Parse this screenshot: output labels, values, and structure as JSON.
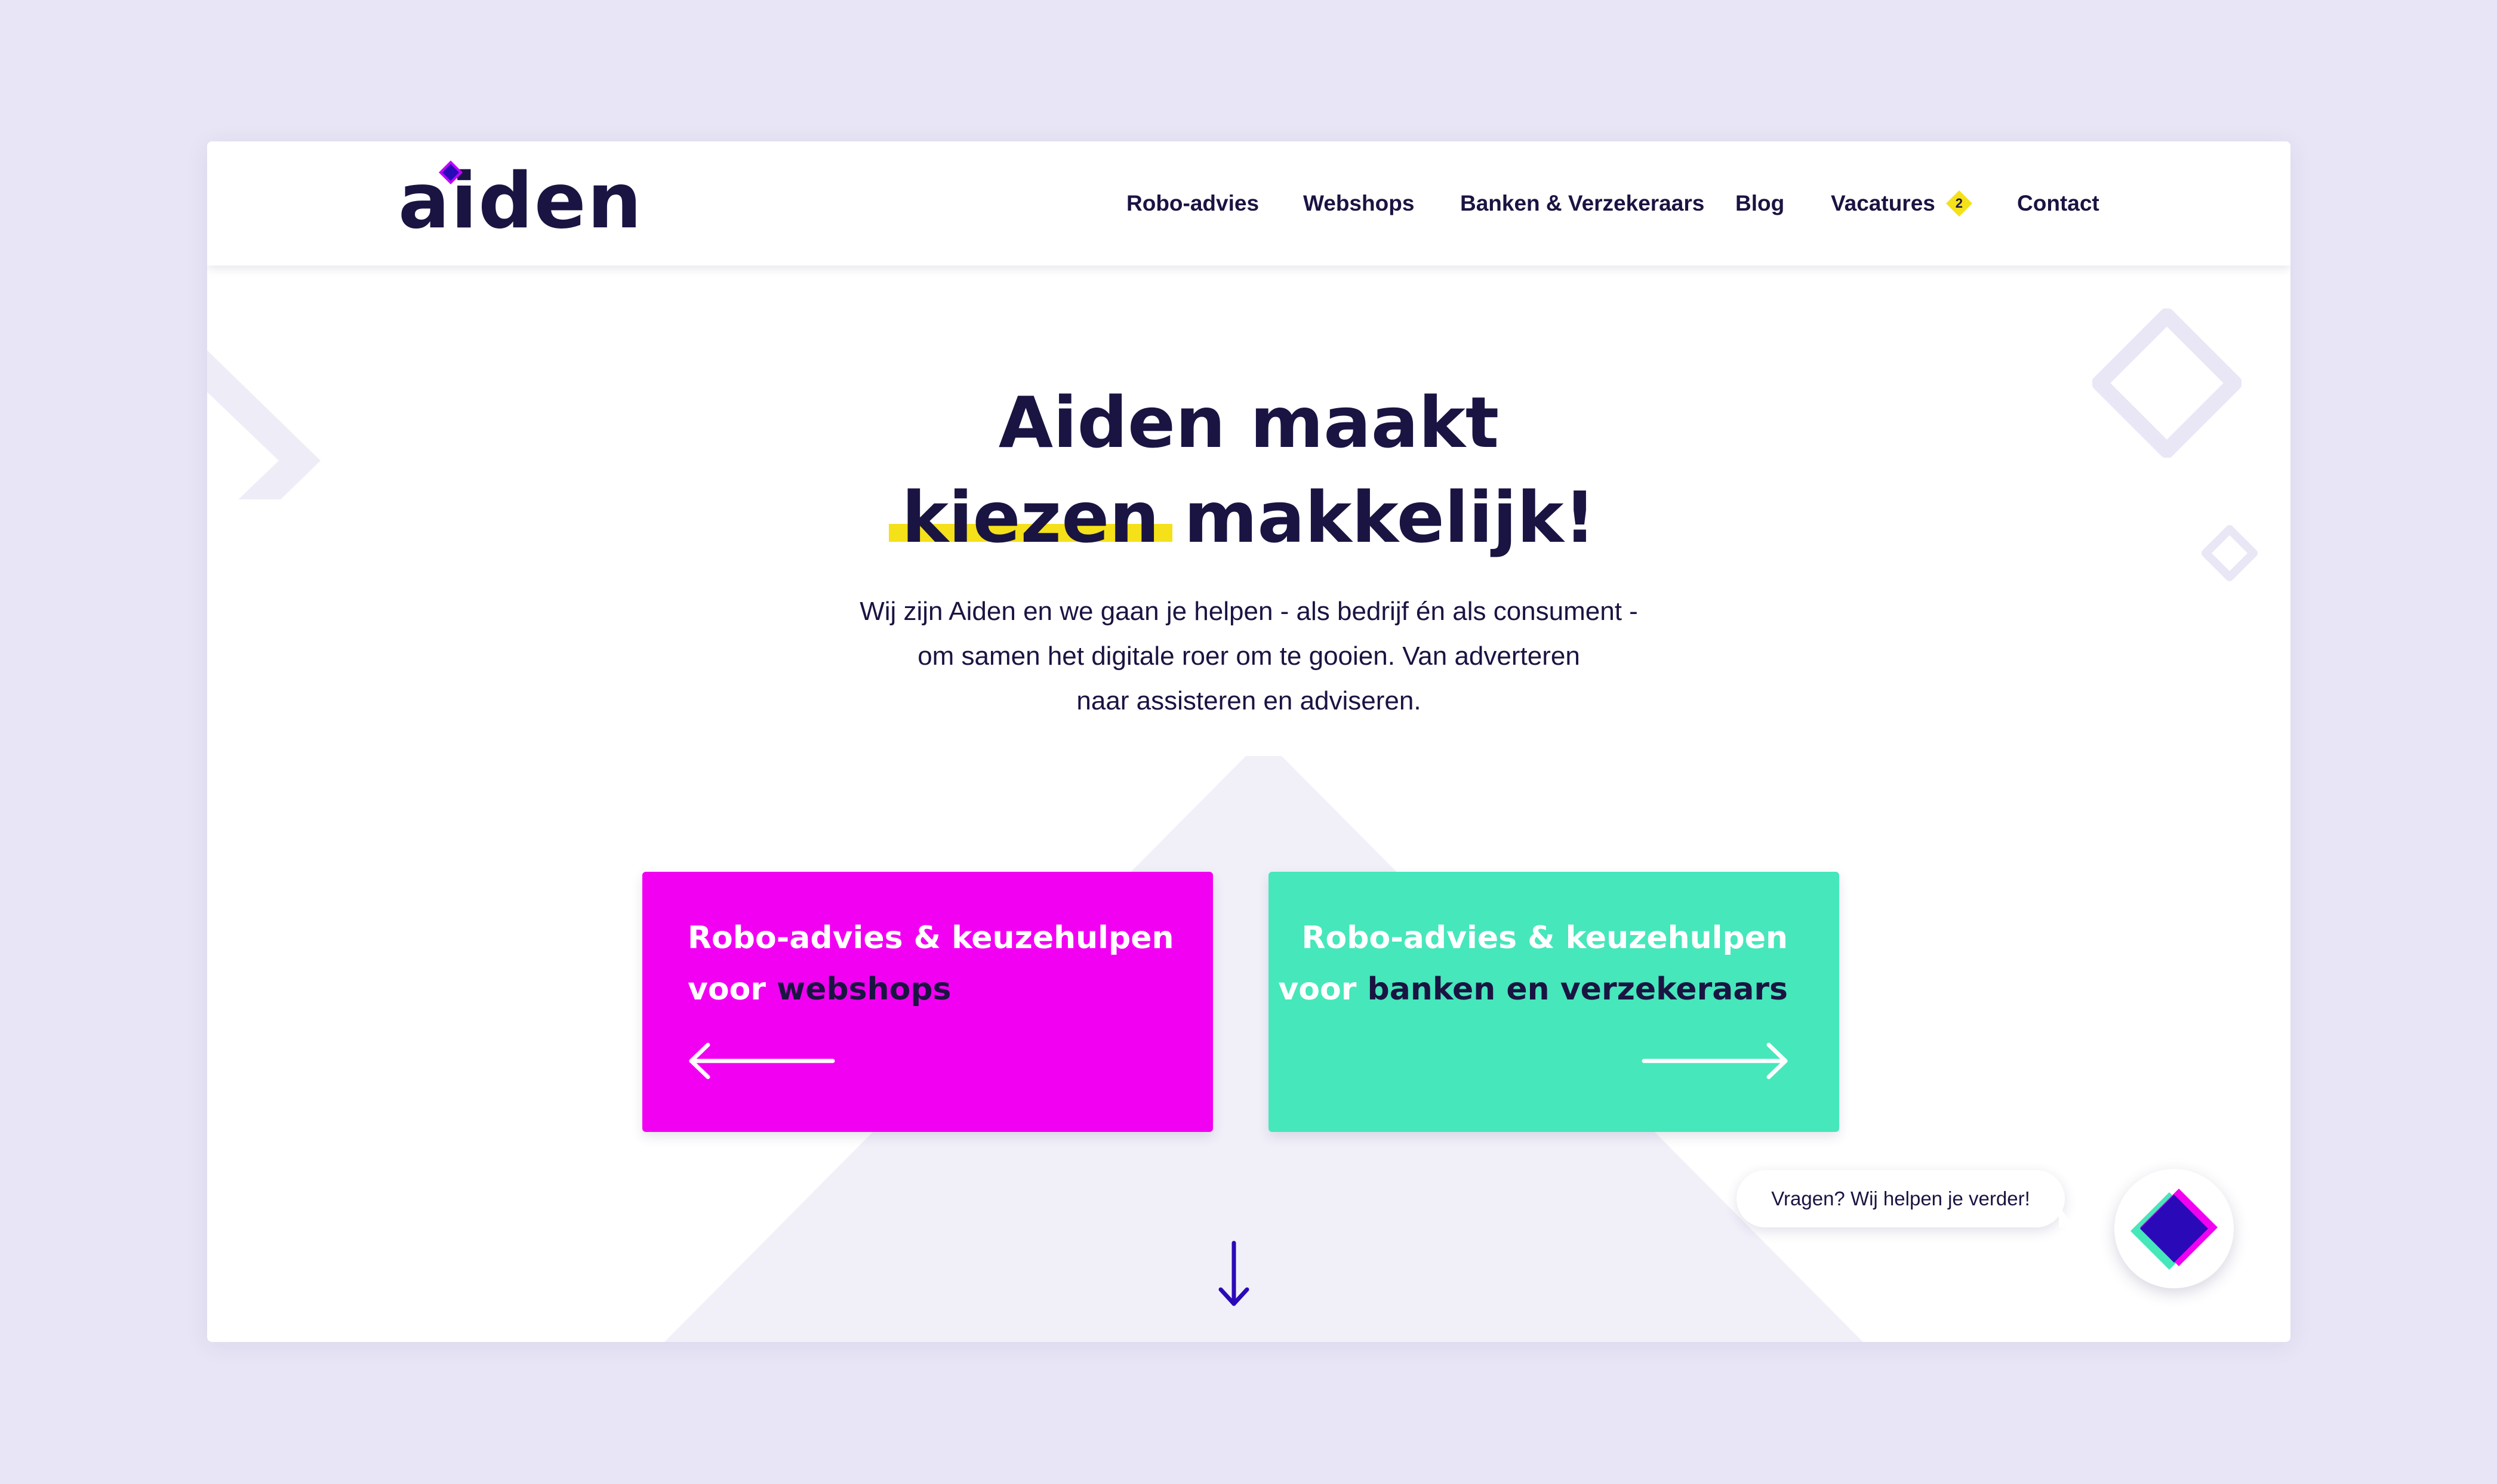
{
  "brand": {
    "logo_text": "aiden",
    "colors": {
      "navy": "#1a1442",
      "magenta": "#f200f2",
      "mint": "#46e7bb",
      "yellow": "#f4e11a",
      "indigo": "#2a0ab8",
      "page_bg": "#e8e5f6"
    }
  },
  "nav": {
    "items": [
      {
        "label": "Robo-advies"
      },
      {
        "label": "Webshops"
      },
      {
        "label": "Banken & Verzekeraars"
      },
      {
        "label": "Blog"
      },
      {
        "label": "Vacatures",
        "badge": "2"
      },
      {
        "label": "Contact"
      }
    ]
  },
  "hero": {
    "title_line1": "Aiden maakt",
    "title_highlight": "kiezen",
    "title_line2_rest": "makkelijk!",
    "intro_lines": [
      "Wij zijn Aiden en we gaan je helpen - als bedrijf én als consument -",
      "om samen het digitale roer om te gooien. Van adverteren",
      "naar assisteren en adviseren."
    ]
  },
  "cards": [
    {
      "line1": "Robo-advies & keuzehulpen",
      "line2_prefix": "voor ",
      "line2_bold": "webshops",
      "arrow_icon": "arrow-left-icon"
    },
    {
      "line1": "Robo-advies & keuzehulpen",
      "line2_prefix": "voor ",
      "line2_bold": "banken en verzekeraars",
      "arrow_icon": "arrow-right-icon"
    }
  ],
  "scroll_icon": "arrow-down-icon",
  "chat": {
    "bubble_text": "Vragen? Wij helpen je verder!",
    "button_icon": "diamond-chat-icon"
  }
}
